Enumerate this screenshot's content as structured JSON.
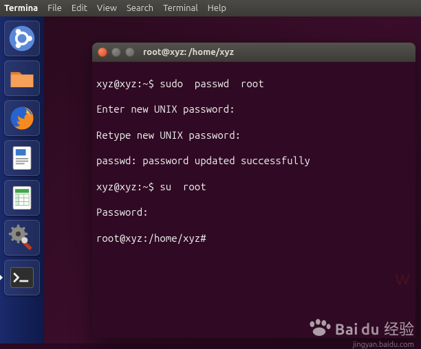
{
  "menubar": {
    "app": "Termina",
    "items": [
      "File",
      "Edit",
      "View",
      "Search",
      "Terminal",
      "Help"
    ]
  },
  "launcher": {
    "items": [
      {
        "name": "dash",
        "active": false
      },
      {
        "name": "files",
        "active": false
      },
      {
        "name": "firefox",
        "active": false
      },
      {
        "name": "writer",
        "active": false
      },
      {
        "name": "calc",
        "active": false
      },
      {
        "name": "settings",
        "active": false
      },
      {
        "name": "terminal",
        "active": true
      }
    ]
  },
  "window": {
    "title": "root@xyz: /home/xyz"
  },
  "terminal": {
    "lines": [
      "xyz@xyz:~$ sudo  passwd  root",
      "Enter new UNIX password:",
      "Retype new UNIX password:",
      "passwd: password updated successfully",
      "xyz@xyz:~$ su  root",
      "Password:",
      "root@xyz:/home/xyz#"
    ]
  },
  "watermark": {
    "brand": "Bai",
    "du": "du",
    "cn": "经验",
    "sub": "jingyan.baidu.com",
    "faint": "w"
  }
}
